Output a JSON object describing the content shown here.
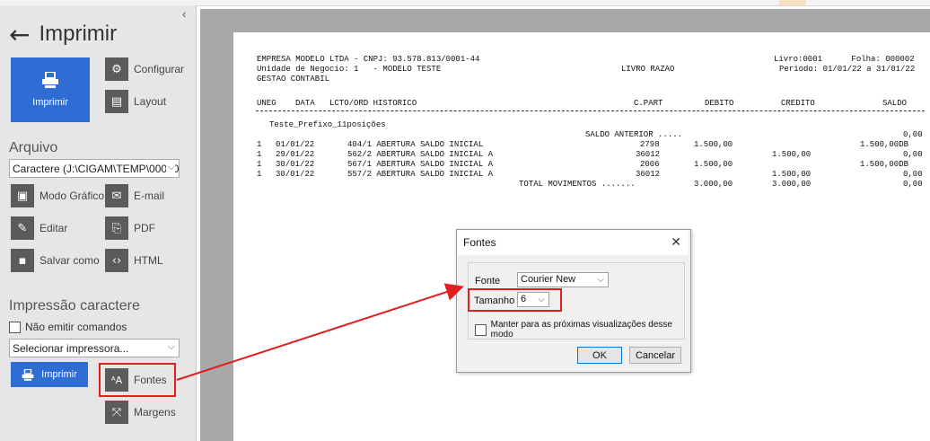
{
  "sidebar": {
    "back_title": "Imprimir",
    "collapse_glyph": "‹",
    "imprimir_big": "Imprimir",
    "configurar": "Configurar",
    "layout": "Layout",
    "arquivo_title": "Arquivo",
    "arquivo_value": "Caractere (J:\\CIGAM\\TEMP\\00000",
    "modo_grafico": "Modo Gráfico",
    "email": "E-mail",
    "editar": "Editar",
    "pdf": "PDF",
    "salvar_como": "Salvar como",
    "html": "HTML",
    "impressao_title": "Impressão caractere",
    "nao_emitir": "Não emitir comandos",
    "impressora_value": "Selecionar impressora...",
    "imprimir_btn": "Imprimir",
    "fontes": "Fontes",
    "margens": "Margens"
  },
  "report": {
    "h1_left": "EMPRESA MODELO LTDA - CNPJ: 93.578.813/0001-44",
    "h1_right": "Livro:0001      Folha: 000002",
    "h2_left": "Unidade de Negocio: 1   - MODELO TESTE",
    "h2_mid": "LIVRO RAZAO",
    "h2_right": "Periodo: 01/01/22 a 31/01/22",
    "h3_left": "GESTAO CONTABIL",
    "col_uneg": "UNEG",
    "col_data": "DATA",
    "col_lcto": "LCTO/ORD HISTORICO",
    "col_cpart": "C.PART",
    "col_debito": "DEBITO",
    "col_credito": "CREDITO",
    "col_saldo": "SALDO",
    "prefix": "Teste_Prefixo_11posições",
    "saldo_anterior_label": "SALDO ANTERIOR .....",
    "saldo_anterior_value": "0,00",
    "rows": [
      {
        "uneg": "1",
        "data": "01/01/22",
        "hist": "404/1 ABERTURA SALDO INICIAL",
        "cpart": "2798",
        "debito": "1.500,00",
        "credito": "",
        "saldo": "1.500,00DB"
      },
      {
        "uneg": "1",
        "data": "29/01/22",
        "hist": "562/2 ABERTURA SALDO INICIAL A",
        "cpart": "36012",
        "debito": "",
        "credito": "1.500,00",
        "saldo": "0,00"
      },
      {
        "uneg": "1",
        "data": "30/01/22",
        "hist": "567/1 ABERTURA SALDO INICIAL A",
        "cpart": "2006",
        "debito": "1.500,00",
        "credito": "",
        "saldo": "1.500,00DB"
      },
      {
        "uneg": "1",
        "data": "30/01/22",
        "hist": "557/2 ABERTURA SALDO INICIAL A",
        "cpart": "36012",
        "debito": "",
        "credito": "1.500,00",
        "saldo": "0,00"
      }
    ],
    "total_label": "TOTAL MOVIMENTOS .......",
    "total_debito": "3.000,00",
    "total_credito": "3.000,00",
    "total_saldo": "0,00"
  },
  "dialog": {
    "title": "Fontes",
    "close": "✕",
    "fonte_label": "Fonte",
    "fonte_value": "Courier New",
    "tamanho_label": "Tamanho",
    "tamanho_value": "6",
    "manter_label": "Manter para as próximas visualizações desse modo",
    "ok": "OK",
    "cancelar": "Cancelar"
  },
  "icons": {
    "back": "back-arrow-icon",
    "printer": "printer-icon",
    "gear": "gear-icon",
    "layout": "layout-icon",
    "mode": "graphic-mode-icon",
    "email": "email-icon",
    "edit": "pencil-icon",
    "pdf": "pdf-icon",
    "save": "save-icon",
    "html": "html-icon",
    "fonts": "fonts-icon",
    "margins": "margins-icon"
  },
  "colors": {
    "accent": "#2f6dd5",
    "highlight": "#e02020",
    "sidebar_bg": "#e6e6e6",
    "viewer_bg": "#a8a8a8"
  }
}
